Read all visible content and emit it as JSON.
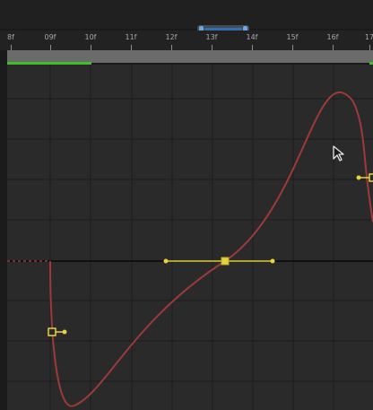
{
  "timeline": {
    "frames": [
      "8f",
      "09f",
      "10f",
      "11f",
      "12f",
      "13f",
      "14f",
      "15f",
      "16f",
      "17"
    ],
    "colors": {
      "range_bar": "#3fbf2a",
      "curve": "#9c3a3a",
      "handle": "#e6d33c",
      "scrubber": "#2f6fb8"
    },
    "icons": [
      "cursor-arrow-icon"
    ]
  }
}
